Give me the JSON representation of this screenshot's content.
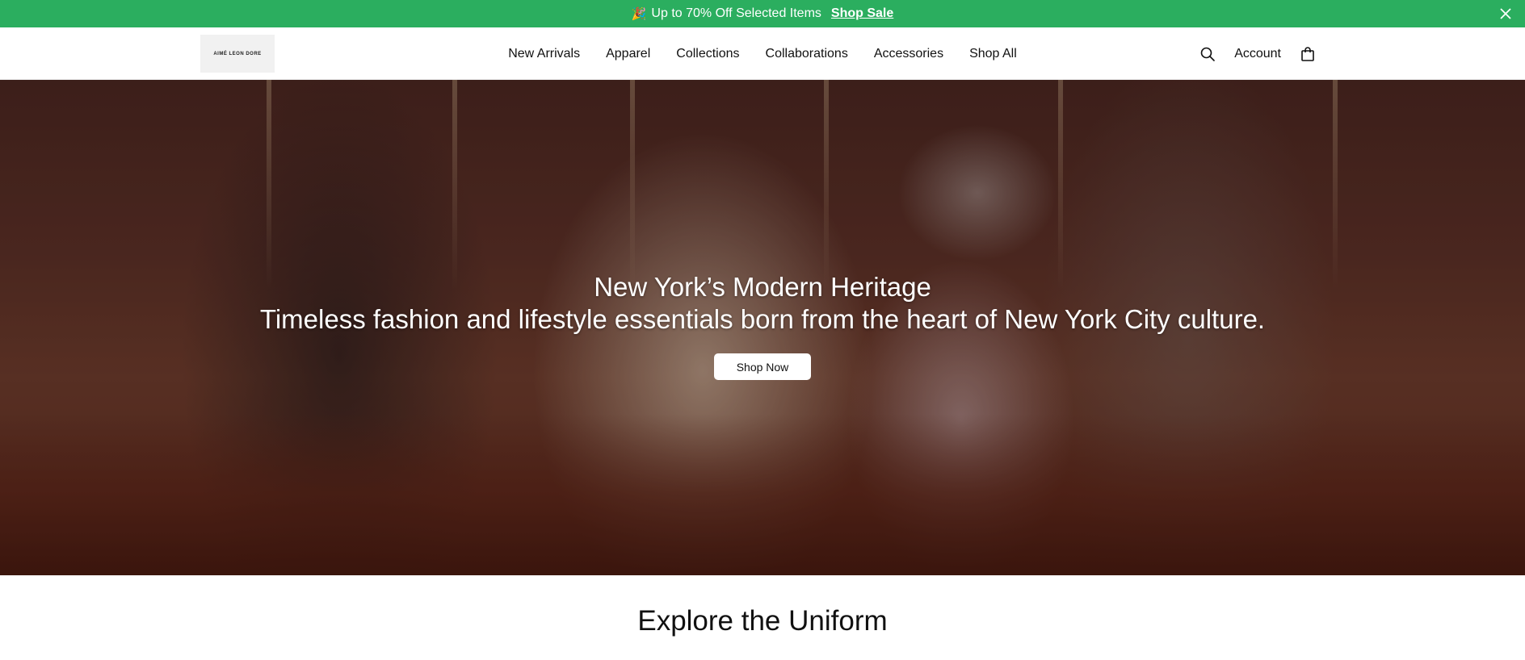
{
  "announcement": {
    "emoji": "🎉",
    "text": "Up to 70% Off Selected Items",
    "link_label": "Shop Sale",
    "close_icon": "close-icon",
    "background_color": "#2bae5f"
  },
  "header": {
    "logo_text": "AIMÉ LEON DORE",
    "nav": [
      {
        "label": "New Arrivals"
      },
      {
        "label": "Apparel"
      },
      {
        "label": "Collections"
      },
      {
        "label": "Collaborations"
      },
      {
        "label": "Accessories"
      },
      {
        "label": "Shop All"
      }
    ],
    "search_icon": "search-icon",
    "account_label": "Account",
    "cart_icon": "shopping-bag-icon"
  },
  "hero": {
    "title": "New York’s Modern Heritage",
    "subtitle": "Timeless fashion and lifestyle essentials born from the heart of New York City culture.",
    "button_label": "Shop Now"
  },
  "section": {
    "title": "Explore the Uniform"
  }
}
